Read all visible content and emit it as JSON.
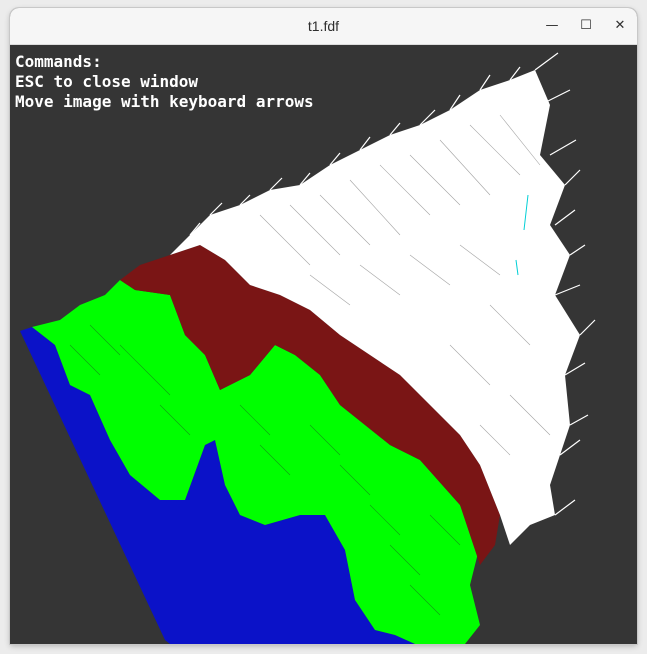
{
  "window": {
    "title": "t1.fdf"
  },
  "controls": {
    "minimize": "—",
    "maximize": "☐",
    "close": "✕"
  },
  "overlay": {
    "lines": [
      "Commands:",
      "ESC to close window",
      "Move image with keyboard arrows"
    ]
  },
  "colors": {
    "background": "#353535",
    "low": "#0b12c8",
    "mid_low": "#00ff00",
    "mid_high": "#7a1515",
    "high": "#ffffff"
  }
}
